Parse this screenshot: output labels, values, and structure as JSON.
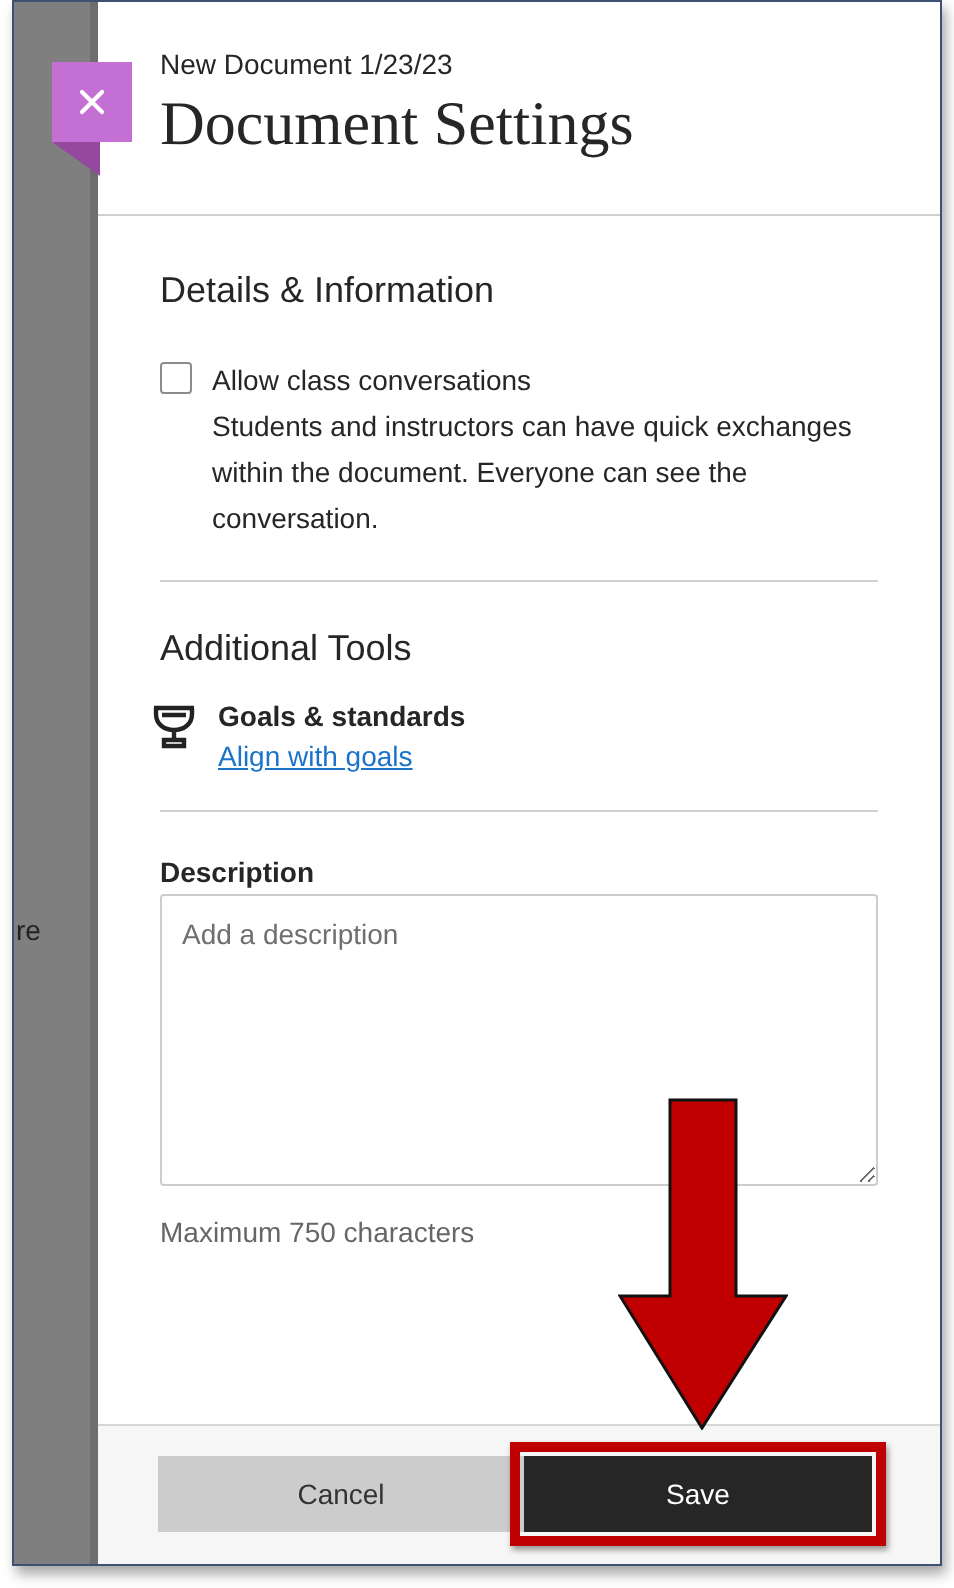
{
  "background": {
    "partial_text": "re"
  },
  "header": {
    "subtitle": "New Document 1/23/23",
    "title": "Document Settings"
  },
  "details": {
    "heading": "Details & Information",
    "checkbox": {
      "label": "Allow class conversations",
      "checked": false,
      "help": "Students and instructors can have quick exchanges within the document. Everyone can see the conversation."
    }
  },
  "tools": {
    "heading": "Additional Tools",
    "item": {
      "title": "Goals & standards",
      "link": "Align with goals"
    }
  },
  "description": {
    "label": "Description",
    "placeholder": "Add a description",
    "hint": "Maximum 750 characters"
  },
  "footer": {
    "buttons": [
      {
        "label": "Cancel",
        "kind": "secondary",
        "highlighted": false
      },
      {
        "label": "Save",
        "kind": "primary",
        "highlighted": true
      }
    ]
  }
}
